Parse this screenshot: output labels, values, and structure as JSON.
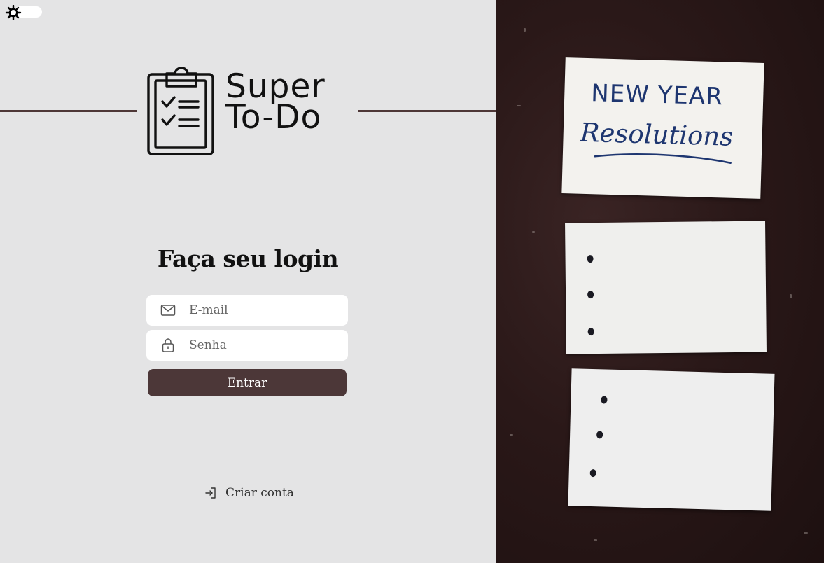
{
  "theme_toggle": {
    "icon": "sun-icon"
  },
  "logo": {
    "icon": "clipboard-checklist-icon",
    "line1": "Super",
    "line2": "To-Do"
  },
  "login": {
    "title": "Faça seu login",
    "email": {
      "placeholder": "E-mail",
      "value": "",
      "icon": "mail-icon"
    },
    "password": {
      "placeholder": "Senha",
      "value": "",
      "icon": "lock-icon"
    },
    "submit_label": "Entrar",
    "create_account": {
      "label": "Criar conta",
      "icon": "sign-in-arrow-icon"
    }
  },
  "photo": {
    "note_headline": "NEW YEAR",
    "note_script": "Resolutions"
  },
  "colors": {
    "background": "#e4e4e5",
    "accent": "#4c3738",
    "photo_background": "#2a1818",
    "note_ink": "#1e3670"
  }
}
